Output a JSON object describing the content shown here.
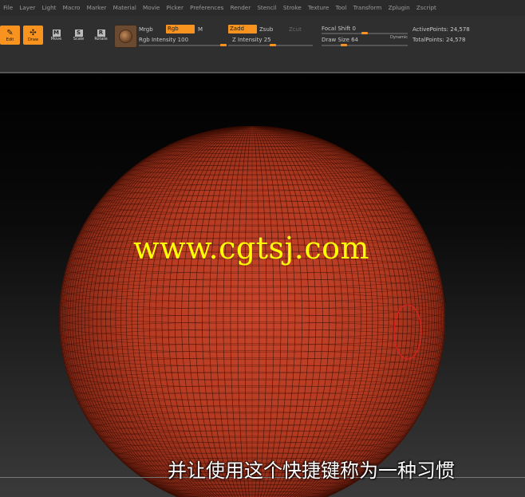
{
  "menu": [
    "File",
    "Layer",
    "Light",
    "Macro",
    "Marker",
    "Material",
    "Movie",
    "Picker",
    "Preferences",
    "Render",
    "Stencil",
    "Stroke",
    "Texture",
    "Tool",
    "Transform",
    "Zplugin",
    "Zscript"
  ],
  "tools": [
    {
      "label": "Edit",
      "glyph": "✎",
      "active": true
    },
    {
      "label": "Draw",
      "glyph": "✣",
      "active": true
    },
    {
      "label": "Move",
      "glyph": "M",
      "active": false
    },
    {
      "label": "Scale",
      "glyph": "S",
      "active": false
    },
    {
      "label": "Rotate",
      "glyph": "R",
      "active": false
    }
  ],
  "brush": {
    "mrgb": "Mrgb",
    "rgb": "Rgb",
    "m": "M",
    "rgb_intensity_label": "Rgb Intensity 100",
    "rgb_intensity": 100,
    "zadd": "Zadd",
    "zsub": "Zsub",
    "zcut": "Zcut",
    "z_intensity_label": "Z Intensity 25",
    "z_intensity": 25
  },
  "draw": {
    "focal_shift_label": "Focal Shift 0",
    "focal_shift": 0,
    "draw_size_label": "Draw Size 64",
    "draw_size": 64,
    "dynamic": "Dynamic"
  },
  "stats": {
    "active_points": "ActivePoints: 24,578",
    "total_points": "TotalPoints: 24,578"
  },
  "watermark": "www.cgtsj.com",
  "subtitle": "并让使用这个快捷键称为一种习惯",
  "colors": {
    "accent": "#f7931e",
    "sphere": "#b83a22",
    "watermark": "#ffff00",
    "cursor": "#e02020"
  }
}
